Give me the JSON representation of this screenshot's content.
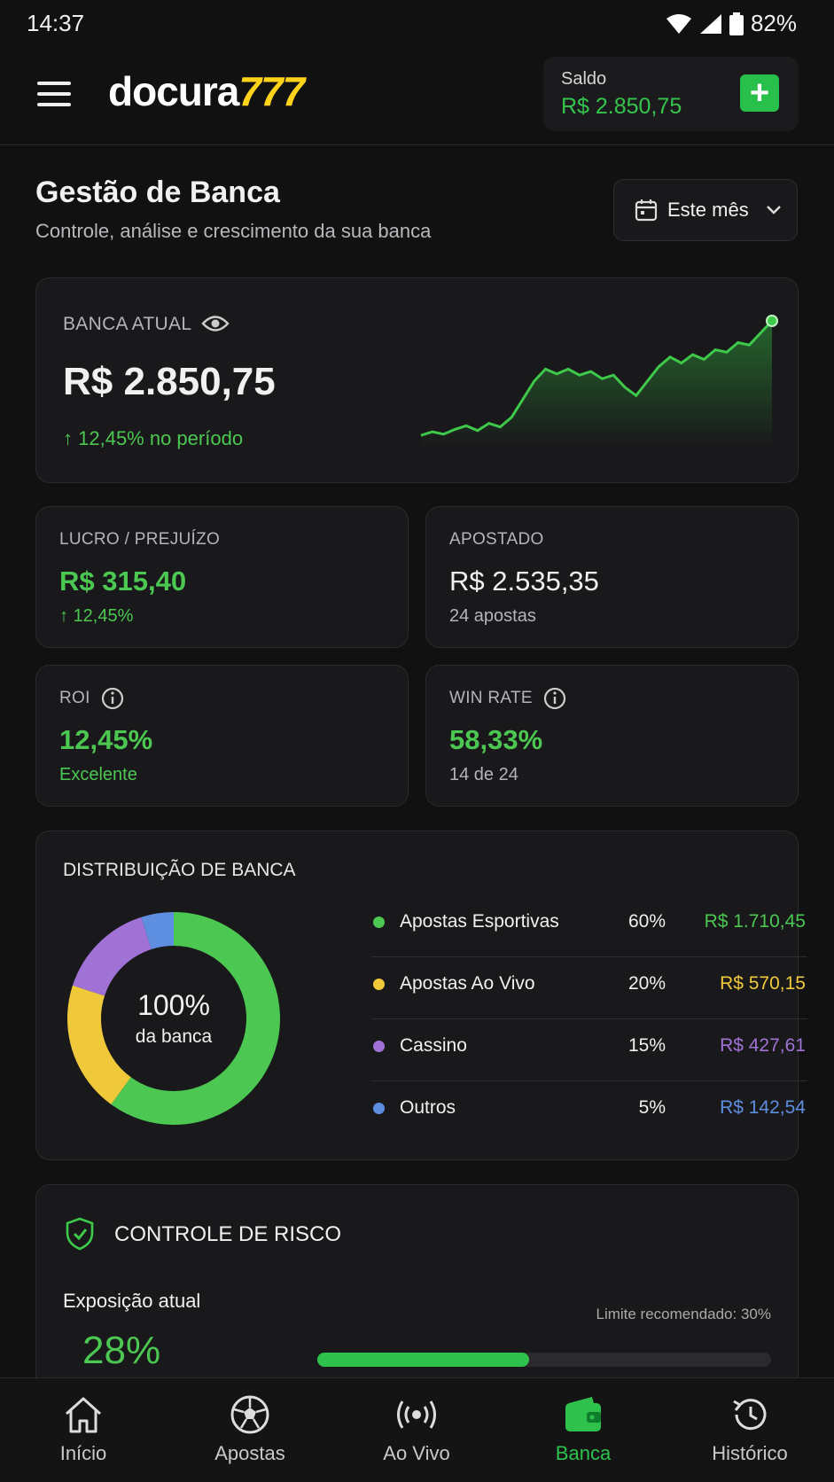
{
  "status_bar": {
    "time": "14:37",
    "battery": "82%"
  },
  "header": {
    "logo_main": "docura",
    "logo_accent": "777",
    "saldo_label": "Saldo",
    "saldo_value": "R$ 2.850,75",
    "add_label": "+"
  },
  "page": {
    "title": "Gestão de Banca",
    "subtitle": "Controle, análise e crescimento da sua banca",
    "period": "Este mês"
  },
  "banca": {
    "label": "BANCA ATUAL",
    "value": "R$ 2.850,75",
    "change": "12,45% no período",
    "sparkline": [
      0.05,
      0.08,
      0.06,
      0.1,
      0.13,
      0.09,
      0.15,
      0.12,
      0.2,
      0.35,
      0.5,
      0.6,
      0.56,
      0.6,
      0.55,
      0.58,
      0.52,
      0.55,
      0.45,
      0.38,
      0.5,
      0.62,
      0.7,
      0.65,
      0.72,
      0.68,
      0.76,
      0.74,
      0.82,
      0.8,
      0.9,
      1.0
    ]
  },
  "stats": [
    {
      "label": "LUCRO / PREJUÍZO",
      "value": "R$ 315,40",
      "sub": "12,45%",
      "value_color": "#4cc752",
      "sub_color": "#4cc752",
      "arrow": "↑"
    },
    {
      "label": "APOSTADO",
      "value": "R$ 2.535,35",
      "sub": "24 apostas",
      "value_color": "#f1f1f1",
      "sub_color": "#b5b5b9",
      "arrow": ""
    },
    {
      "label": "ROI",
      "value": "12,45%",
      "sub": "Excelente",
      "value_color": "#4cc752",
      "sub_color": "#4cc752",
      "arrow": ""
    },
    {
      "label": "WIN RATE",
      "value": "58,33%",
      "sub": "14 de 24",
      "value_color": "#4cc752",
      "sub_color": "#b5b5b9",
      "arrow": ""
    }
  ],
  "distribution": {
    "title": "DISTRIBUIÇÃO DE BANCA",
    "center_value": "100%",
    "center_label": "da banca",
    "items": [
      {
        "name": "Apostas Esportivas",
        "pct": "60%",
        "value": "R$ 1.710,45",
        "color": "#4cc752",
        "share": 0.6
      },
      {
        "name": "Apostas Ao Vivo",
        "pct": "20%",
        "value": "R$ 570,15",
        "color": "#f0c93a",
        "share": 0.2
      },
      {
        "name": "Cassino",
        "pct": "15%",
        "value": "R$ 427,61",
        "color": "#a072d6",
        "share": 0.15
      },
      {
        "name": "Outros",
        "pct": "5%",
        "value": "R$ 142,54",
        "color": "#5e8ee0",
        "share": 0.05
      }
    ]
  },
  "risk": {
    "title": "CONTROLE DE RISCO",
    "exposure_label": "Exposição atual",
    "exposure_value": "28%",
    "limit_label": "Limite recomendado: 30%",
    "exposure_fraction": 0.28
  },
  "nav": [
    {
      "label": "Início",
      "icon": "home-icon"
    },
    {
      "label": "Apostas",
      "icon": "soccer-ball-icon"
    },
    {
      "label": "Ao Vivo",
      "icon": "live-broadcast-icon"
    },
    {
      "label": "Banca",
      "icon": "wallet-icon"
    },
    {
      "label": "Histórico",
      "icon": "history-icon"
    }
  ]
}
